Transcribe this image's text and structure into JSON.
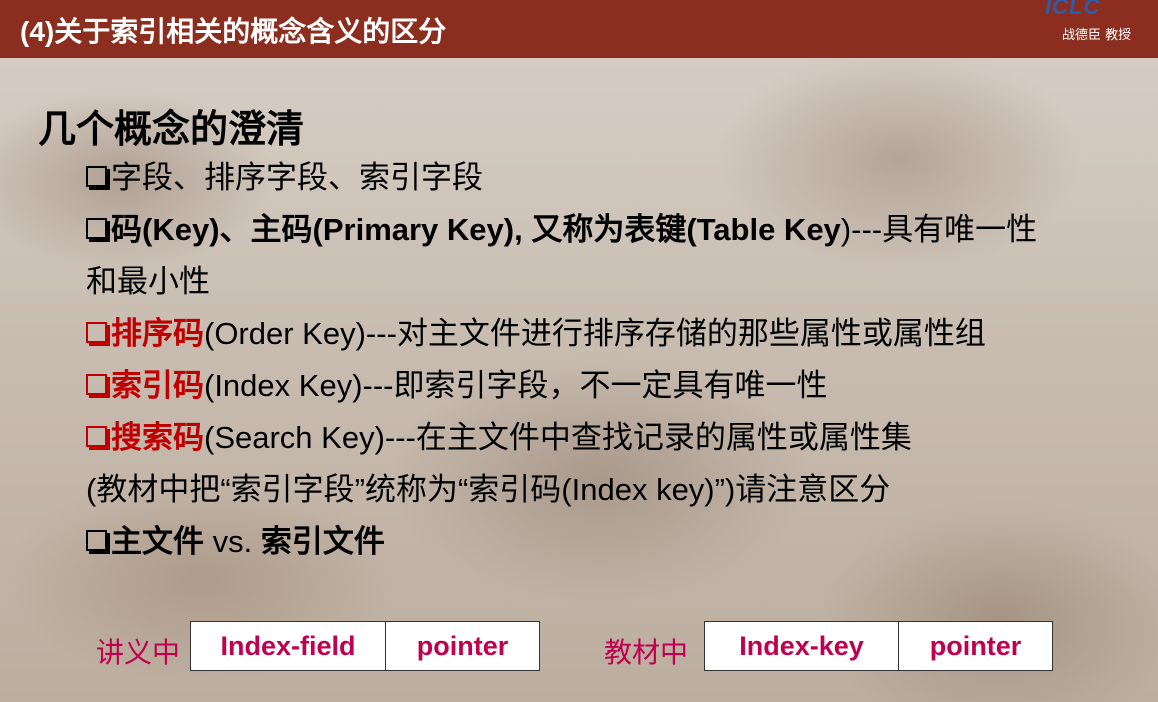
{
  "header": {
    "title": "(4)关于索引相关的概念含义的区分",
    "logo_text": "ICLC",
    "author": "战德臣 教授"
  },
  "heading": "几个概念的澄清",
  "items": {
    "l1": "字段、排序字段、索引字段",
    "l2_bold": "码(Key)、主码(Primary Key), 又称为表键(Table Key",
    "l2_rest": ")---具有唯一性",
    "l2_cont": "和最小性",
    "l3_red": "排序码",
    "l3_rest": "(Order Key)---对主文件进行排序存储的那些属性或属性组",
    "l4_red": "索引码",
    "l4_rest": "(Index Key)---即索引字段，不一定具有唯一性",
    "l5_red": "搜索码",
    "l5_rest": "(Search Key)---在主文件中查找记录的属性或属性集",
    "l6": "(教材中把“索引字段”统称为“索引码(Index key)”)请注意区分",
    "l7_a": "主文件",
    "l7_mid": " vs. ",
    "l7_b": "索引文件"
  },
  "diagram": {
    "left_label": "讲义中",
    "left_cells": [
      "Index-field",
      "pointer"
    ],
    "right_label": "教材中",
    "right_cells": [
      "Index-key",
      "pointer"
    ]
  },
  "colors": {
    "header_bg": "#8b2e1f",
    "accent_red": "#c00000",
    "diagram_text": "#c0004e"
  }
}
